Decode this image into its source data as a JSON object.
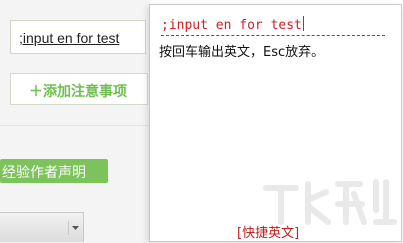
{
  "left_form": {
    "input_value": ";input en for test",
    "add_button_label": "＋添加注意事项",
    "declare_button_label": "经验作者声明"
  },
  "ime_panel": {
    "composition_text": ";input en for test",
    "hint_text": "按回车输出英文，Esc放弃。",
    "mode_label": "[快捷英文]"
  },
  "colors": {
    "accent_green": "#7cc35c",
    "ime_red": "#d02020"
  }
}
